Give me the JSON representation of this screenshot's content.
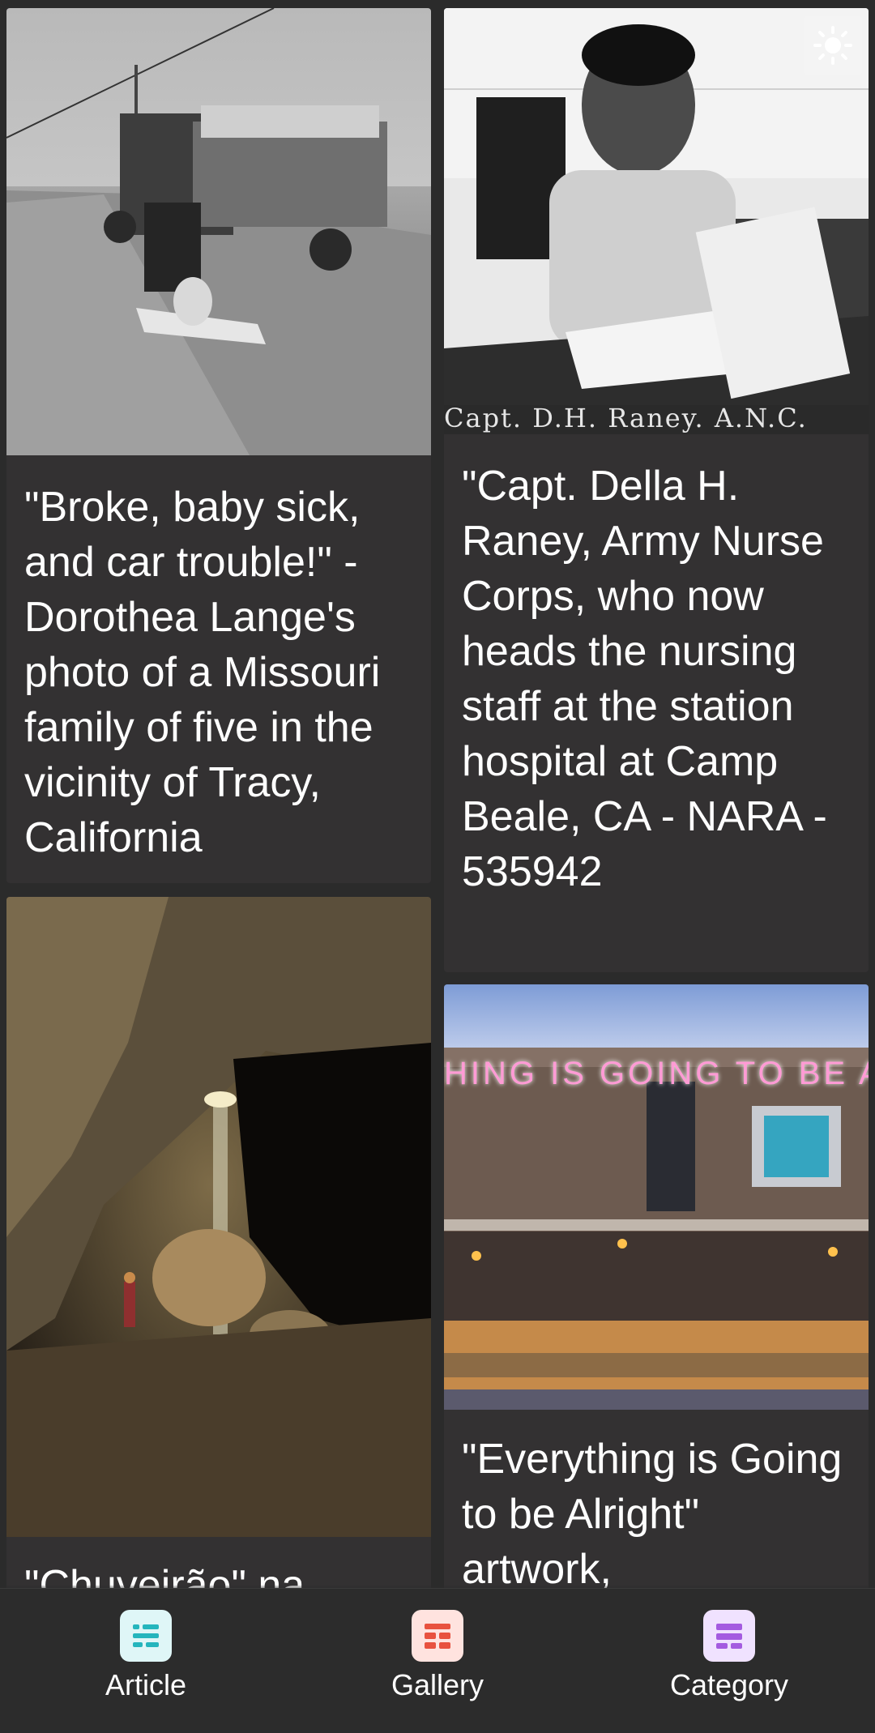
{
  "cards": [
    {
      "caption": "\"Broke, baby sick, and car trouble!\" - Dorothea Lange's photo of a Missouri family of five in the vicinity of Tracy, California"
    },
    {
      "caption": "\"Capt. Della H. Raney, Army Nurse Corps, who now heads the nursing staff at the station hospital at Camp Beale, CA - NARA - 535942",
      "image_text": "Capt. D.H. Raney. A.N.C."
    },
    {
      "caption": "\"Chuveirão\" na"
    },
    {
      "caption": "\"Everything is Going to be Alright\" artwork,",
      "image_text": "HING IS GOING TO BE A"
    }
  ],
  "bottom_nav": {
    "items": [
      {
        "label": "Article",
        "icon": "article-icon",
        "color": "#25b5bd"
      },
      {
        "label": "Gallery",
        "icon": "gallery-icon",
        "color": "#e8523f"
      },
      {
        "label": "Category",
        "icon": "category-icon",
        "color": "#a45be0"
      }
    ]
  },
  "colors": {
    "background": "#2b2b2b",
    "card": "#333132",
    "text": "#ffffff"
  }
}
